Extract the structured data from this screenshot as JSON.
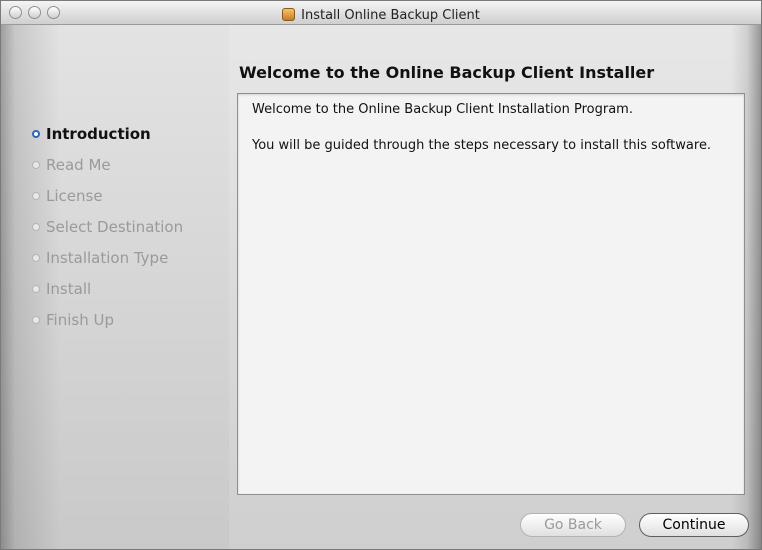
{
  "window": {
    "title": "Install Online Backup Client"
  },
  "header": {
    "title": "Welcome to the Online Backup Client Installer"
  },
  "steps": [
    {
      "label": "Introduction",
      "active": true
    },
    {
      "label": "Read Me",
      "active": false
    },
    {
      "label": "License",
      "active": false
    },
    {
      "label": "Select Destination",
      "active": false
    },
    {
      "label": "Installation Type",
      "active": false
    },
    {
      "label": "Install",
      "active": false
    },
    {
      "label": "Finish Up",
      "active": false
    }
  ],
  "content": {
    "line1": "Welcome to the Online Backup Client Installation Program.",
    "line2": "You will be guided through the steps necessary to install this software."
  },
  "buttons": {
    "back": "Go Back",
    "continue": "Continue"
  }
}
